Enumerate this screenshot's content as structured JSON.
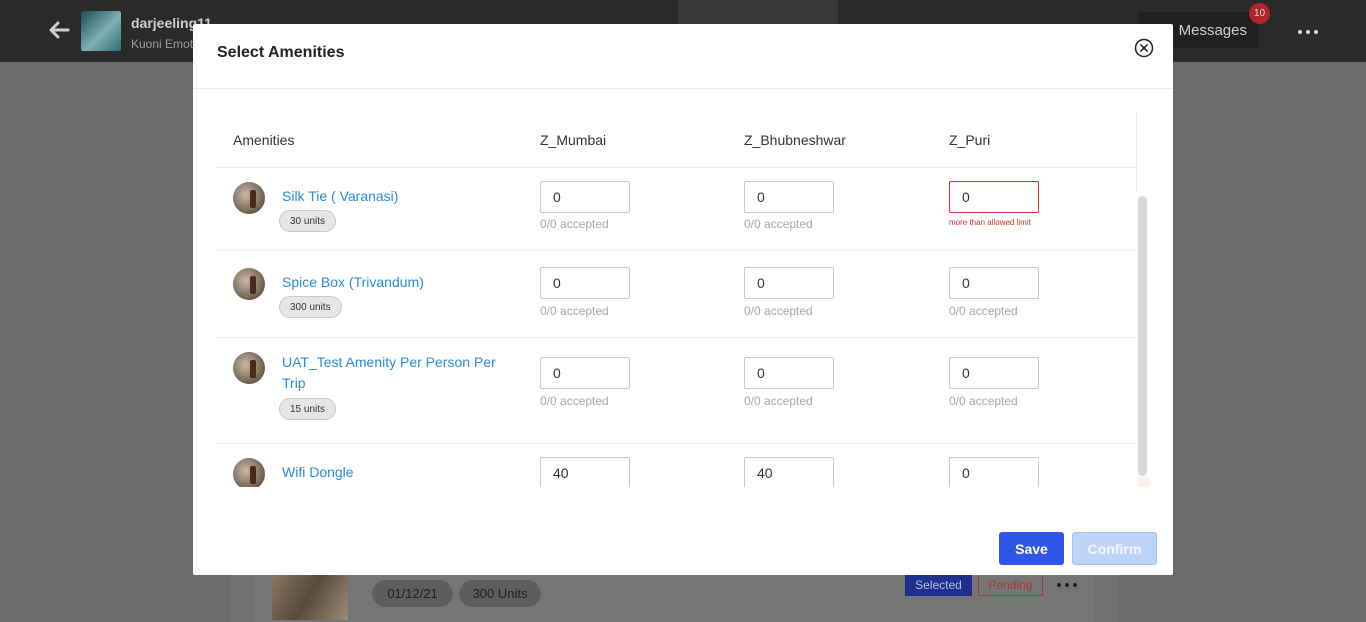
{
  "background": {
    "trip_name": "darjeeling11",
    "trip_sub": "Kuoni Emot",
    "messages_label": "Messages",
    "messages_count": "10",
    "bg_item": {
      "date": "01/12/21",
      "units": "300 Units",
      "selected": "Selected",
      "pending": "Pending"
    }
  },
  "modal": {
    "title": "Select Amenities",
    "columns": [
      "Amenities",
      "Z_Mumbai",
      "Z_Bhubneshwar",
      "Z_Puri"
    ],
    "rows": [
      {
        "name": "Silk Tie ( Varanasi)",
        "units": "30 units",
        "cells": [
          {
            "value": "0",
            "accepted": "0/0 accepted"
          },
          {
            "value": "0",
            "accepted": "0/0 accepted"
          },
          {
            "value": "0",
            "error": "more than allowed limit"
          }
        ]
      },
      {
        "name": "Spice Box (Trivandum)",
        "units": "300 units",
        "cells": [
          {
            "value": "0",
            "accepted": "0/0 accepted"
          },
          {
            "value": "0",
            "accepted": "0/0 accepted"
          },
          {
            "value": "0",
            "accepted": "0/0 accepted"
          }
        ]
      },
      {
        "name": "UAT_Test Amenity Per Person Per Trip",
        "units": "15 units",
        "cells": [
          {
            "value": "0",
            "accepted": "0/0 accepted"
          },
          {
            "value": "0",
            "accepted": "0/0 accepted"
          },
          {
            "value": "0",
            "accepted": "0/0 accepted"
          }
        ]
      },
      {
        "name": "Wifi Dongle",
        "cells": [
          {
            "value": "40"
          },
          {
            "value": "40"
          },
          {
            "value": "0"
          }
        ]
      }
    ],
    "save_label": "Save",
    "confirm_label": "Confirm"
  }
}
